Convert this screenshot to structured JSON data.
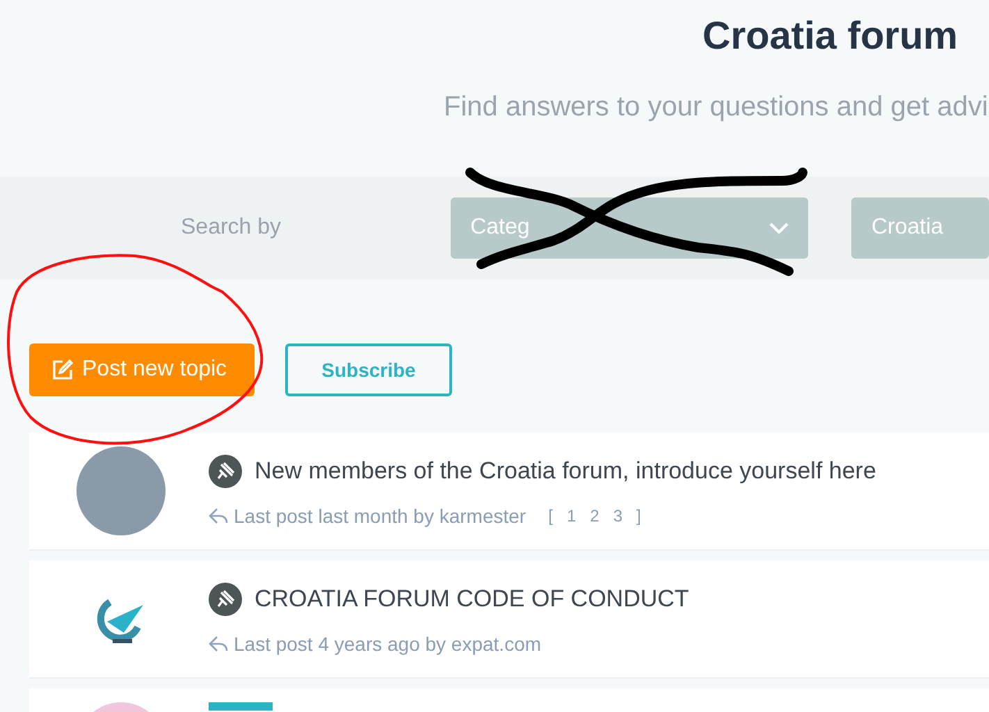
{
  "header": {
    "title": "Croatia forum",
    "subtitle": "Find answers to your questions and get advi"
  },
  "search": {
    "label": "Search by",
    "category": {
      "value": "Categ"
    },
    "country": {
      "value": "Croatia"
    }
  },
  "actions": {
    "primary": "Post new topic",
    "secondary": "Subscribe"
  },
  "topics": [
    {
      "kind": "photo",
      "pinned": true,
      "title": "New members of the Croatia forum, introduce yourself here",
      "last_post": "Last post last month by karmester",
      "pager": {
        "open": "[",
        "pages": [
          "1",
          "2",
          "3"
        ],
        "close": "]"
      }
    },
    {
      "kind": "logo",
      "pinned": true,
      "title": "CROATIA FORUM CODE OF CONDUCT",
      "last_post": "Last post 4 years ago by expat.com"
    },
    {
      "kind": "pink",
      "pinned": false
    }
  ],
  "annotations": [
    {
      "kind": "circle"
    },
    {
      "kind": "cross"
    }
  ]
}
